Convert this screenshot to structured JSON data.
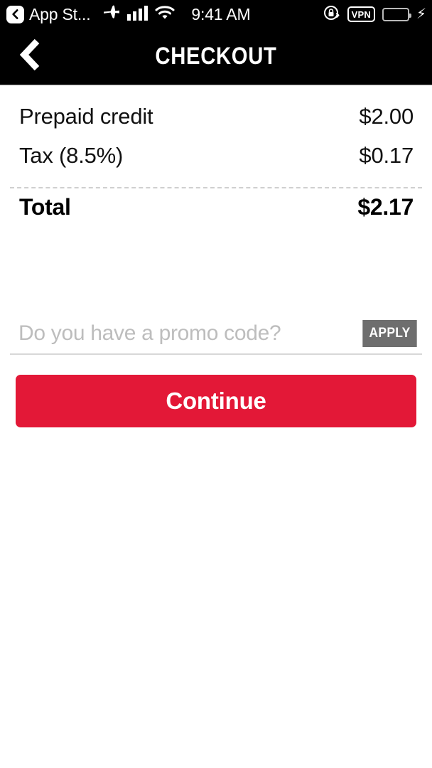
{
  "status_bar": {
    "back_icon": "back-chevron-badge-icon",
    "app_name": "App St...",
    "airplane_icon": "airplane-icon",
    "signal_icon": "cellular-signal-icon",
    "wifi_icon": "wifi-icon",
    "time": "9:41 AM",
    "rotation_lock_icon": "rotation-lock-icon",
    "vpn_label": "VPN",
    "battery_icon": "battery-icon",
    "charging_icon": "lightning-bolt-icon",
    "battery_color": "#5ce65c",
    "background_color": "#000000"
  },
  "header": {
    "back_icon": "chevron-left-icon",
    "title": "CHECKOUT",
    "background_color": "#000000",
    "title_color": "#ffffff"
  },
  "summary": {
    "rows": [
      {
        "label": "Prepaid credit",
        "value": "$2.00"
      },
      {
        "label": "Tax (8.5%)",
        "value": "$0.17"
      }
    ],
    "total": {
      "label": "Total",
      "value": "$2.17"
    }
  },
  "promo": {
    "placeholder": "Do you have a promo code?",
    "value": "",
    "apply_label": "APPLY",
    "apply_color": "#6e6e6e"
  },
  "actions": {
    "continue_label": "Continue",
    "continue_color": "#e31837"
  }
}
